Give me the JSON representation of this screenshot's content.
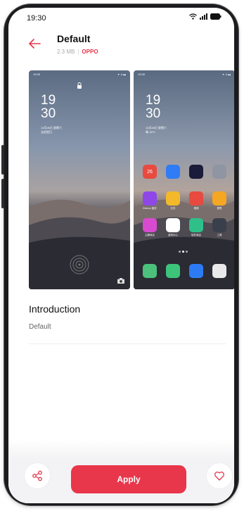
{
  "status_bar": {
    "time": "19:30"
  },
  "header": {
    "title": "Default",
    "size": "2.3 MB",
    "separator": "|",
    "author": "OPPO"
  },
  "preview_lock": {
    "status_time": "19:30",
    "clock_hour": "19",
    "clock_minute": "30",
    "date_line1": "10月26日 星期六",
    "date_line2": "法定假日"
  },
  "preview_home": {
    "status_time": "19:30",
    "clock_hour": "19",
    "clock_minute": "30",
    "date_line1": "10月26日 星期六",
    "date_line2": "晴 18°C",
    "apps": [
      {
        "label": "26",
        "color": "#e84a3f"
      },
      {
        "label": "",
        "color": "#2f7cf6"
      },
      {
        "label": "",
        "color": "#1a1c3a"
      },
      {
        "label": "",
        "color": "#8f95a2"
      },
      {
        "label": "Breeno 速览",
        "color": "#8f47e8"
      },
      {
        "label": "文件",
        "color": "#f3b92b"
      },
      {
        "label": "视频",
        "color": "#e84a3f"
      },
      {
        "label": "便签",
        "color": "#f5a623"
      },
      {
        "label": "主题商店",
        "color": "#d84bd0"
      },
      {
        "label": "游戏中心",
        "color": "#ffffff"
      },
      {
        "label": "软件商店",
        "color": "#2fc08a"
      },
      {
        "label": "工具",
        "color": "#3a3f4c"
      }
    ],
    "dock": [
      {
        "color": "#4cc17c"
      },
      {
        "color": "#3cc47a"
      },
      {
        "color": "#2d7bf4"
      },
      {
        "color": "#e9e9ea"
      }
    ]
  },
  "introduction": {
    "title": "Introduction",
    "text": "Default"
  },
  "actions": {
    "apply_label": "Apply"
  },
  "colors": {
    "accent": "#e8364b"
  }
}
